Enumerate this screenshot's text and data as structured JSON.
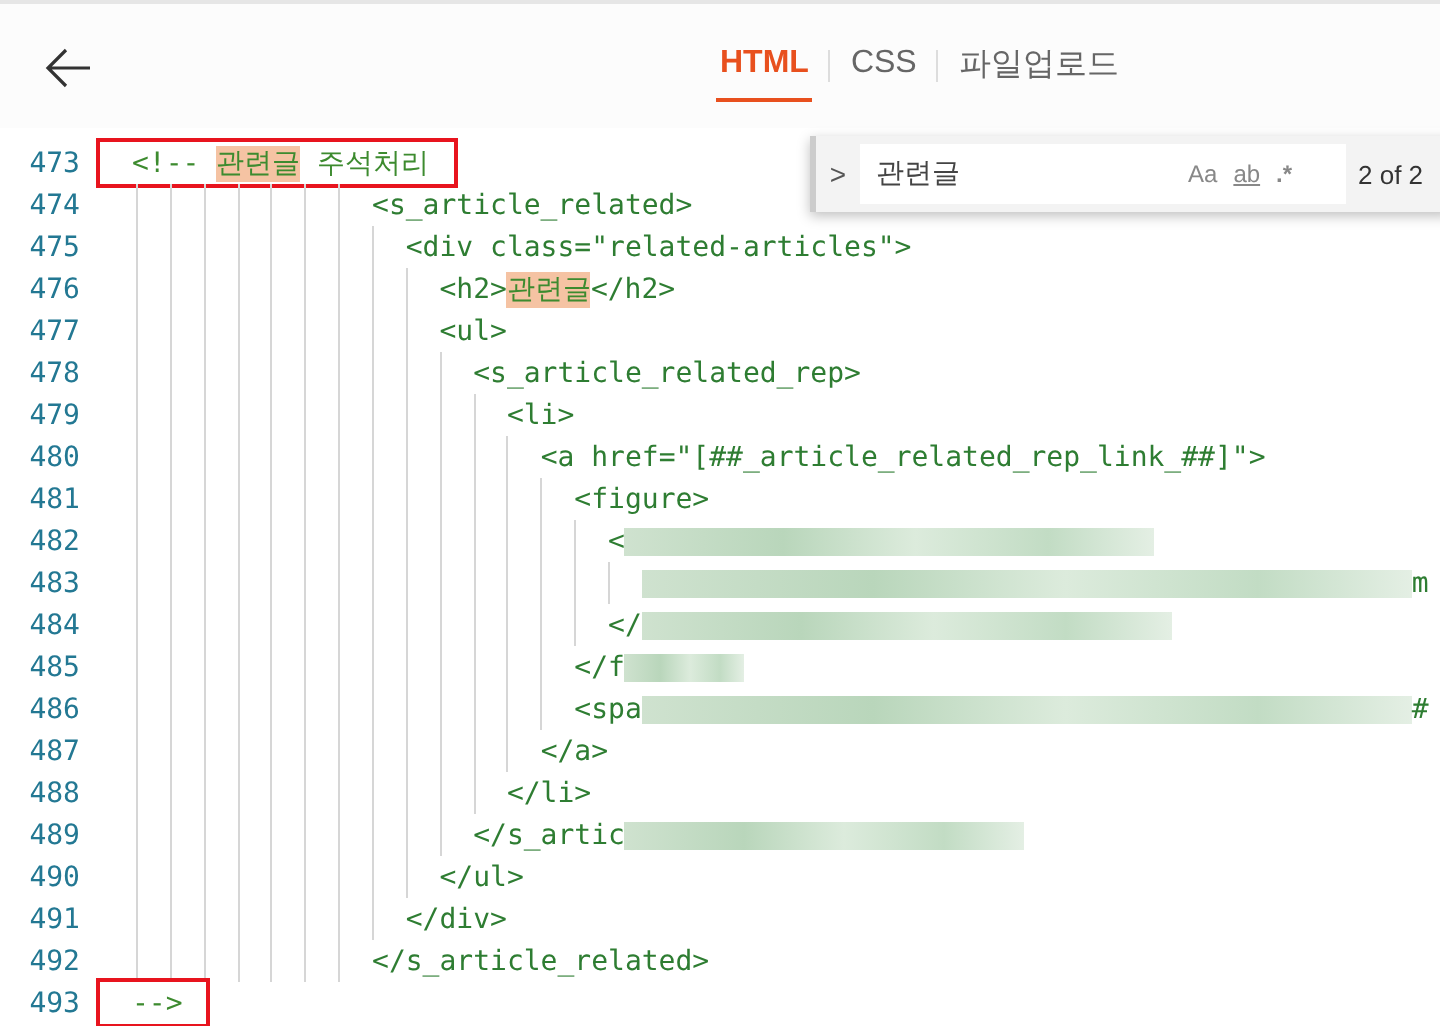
{
  "header": {
    "tabs": [
      {
        "label": "HTML",
        "selected": true
      },
      {
        "label": "CSS",
        "selected": false
      },
      {
        "label": "파일업로드",
        "selected": false
      }
    ]
  },
  "search": {
    "toggle": ">",
    "value": "관련글",
    "options": [
      {
        "label": "Aa",
        "kind": "plain"
      },
      {
        "label": "ab",
        "kind": "underline"
      },
      {
        "label": ".*",
        "kind": "regex"
      }
    ],
    "count": "2 of 2"
  },
  "lines": [
    {
      "number": "473",
      "annotated": true,
      "parts": [
        {
          "kind": "comment",
          "text": "<!-- "
        },
        {
          "kind": "match",
          "text": "관련글"
        },
        {
          "kind": "comment",
          "text": " 주석처리"
        }
      ]
    },
    {
      "number": "474",
      "annotated": false,
      "parts": [
        {
          "kind": "code",
          "text": "              <s_article_related>"
        }
      ]
    },
    {
      "number": "475",
      "annotated": false,
      "parts": [
        {
          "kind": "code",
          "text": "                <div class=\"related-articles\">"
        }
      ]
    },
    {
      "number": "476",
      "annotated": false,
      "parts": [
        {
          "kind": "code",
          "text": "                  <h2>"
        },
        {
          "kind": "match",
          "text": "관련글"
        },
        {
          "kind": "code",
          "text": "</h2>"
        }
      ]
    },
    {
      "number": "477",
      "annotated": false,
      "parts": [
        {
          "kind": "code",
          "text": "                  <ul>"
        }
      ]
    },
    {
      "number": "478",
      "annotated": false,
      "parts": [
        {
          "kind": "code",
          "text": "                    <s_article_related_rep>"
        }
      ]
    },
    {
      "number": "479",
      "annotated": false,
      "parts": [
        {
          "kind": "code",
          "text": "                      <li>"
        }
      ]
    },
    {
      "number": "480",
      "annotated": false,
      "parts": [
        {
          "kind": "code",
          "text": "                        <a href=\"[##_article_related_rep_link_##]\">"
        }
      ]
    },
    {
      "number": "481",
      "annotated": false,
      "parts": [
        {
          "kind": "code",
          "text": "                          <figure>"
        }
      ]
    },
    {
      "number": "482",
      "annotated": false,
      "parts": [
        {
          "kind": "code",
          "text": "                            <"
        },
        {
          "kind": "blur-long"
        }
      ]
    },
    {
      "number": "483",
      "annotated": false,
      "kind": "wrapped",
      "parts": [
        {
          "kind": "blur-xlong"
        },
        {
          "kind": "code",
          "text": "m"
        }
      ]
    },
    {
      "number": "484",
      "annotated": false,
      "parts": [
        {
          "kind": "code",
          "text": "                            </"
        },
        {
          "kind": "blur-long"
        }
      ]
    },
    {
      "number": "485",
      "annotated": false,
      "parts": [
        {
          "kind": "code",
          "text": "                          </f"
        },
        {
          "kind": "blur-short"
        }
      ]
    },
    {
      "number": "486",
      "annotated": false,
      "parts": [
        {
          "kind": "code",
          "text": "                          <spa"
        },
        {
          "kind": "blur-xlong"
        },
        {
          "kind": "code",
          "text": "#"
        }
      ]
    },
    {
      "number": "487",
      "annotated": false,
      "parts": [
        {
          "kind": "code",
          "text": "                        </a>"
        }
      ]
    },
    {
      "number": "488",
      "annotated": false,
      "parts": [
        {
          "kind": "code",
          "text": "                      </li>"
        }
      ]
    },
    {
      "number": "489",
      "annotated": false,
      "parts": [
        {
          "kind": "code",
          "text": "                    </s_artic"
        },
        {
          "kind": "blur-medium"
        }
      ]
    },
    {
      "number": "490",
      "annotated": false,
      "parts": [
        {
          "kind": "code",
          "text": "                  </ul>"
        }
      ]
    },
    {
      "number": "491",
      "annotated": false,
      "parts": [
        {
          "kind": "code",
          "text": "                </div>"
        }
      ]
    },
    {
      "number": "492",
      "annotated": false,
      "parts": [
        {
          "kind": "code",
          "text": "              </s_article_related>"
        }
      ]
    },
    {
      "number": "493",
      "annotated": true,
      "parts": [
        {
          "kind": "comment",
          "text": "-->"
        }
      ]
    }
  ]
}
